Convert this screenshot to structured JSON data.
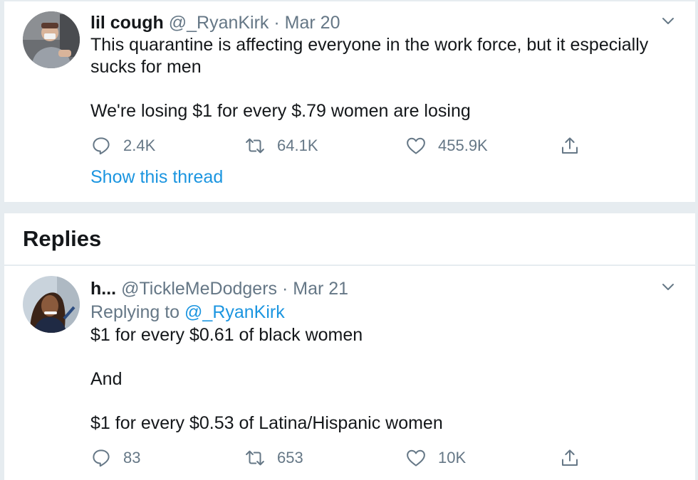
{
  "tweet": {
    "display_name": "lil cough",
    "handle": "@_RyanKirk",
    "separator": "·",
    "date": "Mar 20",
    "lines": [
      "This quarantine is affecting everyone in the work force, but it especially",
      "sucks for men",
      "",
      "We're losing $1 for every $.79 women are losing"
    ],
    "replies": "2.4K",
    "retweets": "64.1K",
    "likes": "455.9K",
    "show_thread": "Show this thread"
  },
  "replies_heading": "Replies",
  "reply": {
    "display_name": "h...",
    "handle": "@TickleMeDodgers",
    "separator": "·",
    "date": "Mar 21",
    "replying_prefix": "Replying to",
    "replying_to": "@_RyanKirk",
    "lines": [
      "$1 for every $0.61 of black women",
      "",
      "And",
      "",
      "$1 for every $0.53 of Latina/Hispanic women"
    ],
    "replies": "83",
    "retweets": "653",
    "likes": "10K"
  },
  "colors": {
    "text": "#14171a",
    "secondary": "#657786",
    "link": "#1b95e0",
    "divider": "#e6ecf0"
  }
}
